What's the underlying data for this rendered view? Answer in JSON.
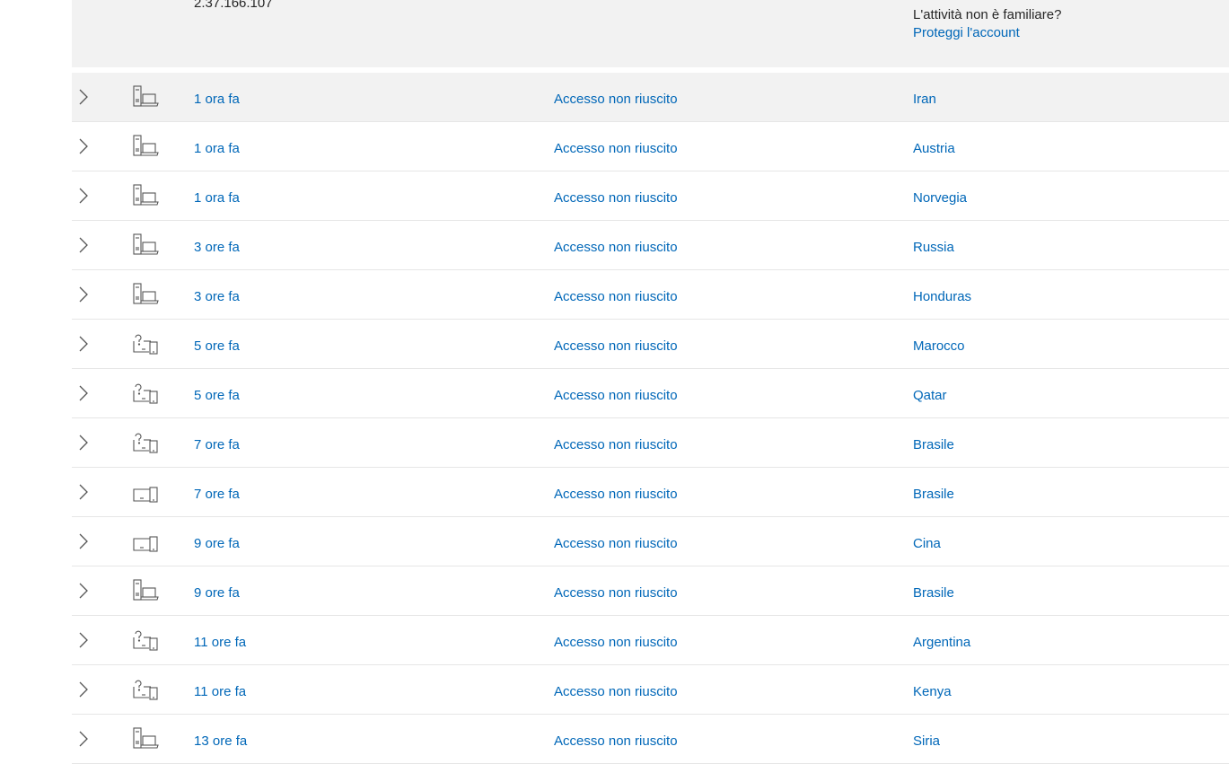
{
  "expanded": {
    "ip": "2.37.166.107",
    "question": "L'attività non è familiare?",
    "link": "Proteggi l'account"
  },
  "icons": {
    "chevron": "chevron-right-icon",
    "computer": "desktop-laptop-icon",
    "unknown": "unknown-device-icon",
    "tablet": "tablet-phone-icon"
  },
  "rows": [
    {
      "time": "1 ora fa",
      "status": "Accesso non riuscito",
      "location": "Iran",
      "device": "computer"
    },
    {
      "time": "1 ora fa",
      "status": "Accesso non riuscito",
      "location": "Austria",
      "device": "computer"
    },
    {
      "time": "1 ora fa",
      "status": "Accesso non riuscito",
      "location": "Norvegia",
      "device": "computer"
    },
    {
      "time": "3 ore fa",
      "status": "Accesso non riuscito",
      "location": "Russia",
      "device": "computer"
    },
    {
      "time": "3 ore fa",
      "status": "Accesso non riuscito",
      "location": "Honduras",
      "device": "computer"
    },
    {
      "time": "5 ore fa",
      "status": "Accesso non riuscito",
      "location": "Marocco",
      "device": "unknown"
    },
    {
      "time": "5 ore fa",
      "status": "Accesso non riuscito",
      "location": "Qatar",
      "device": "unknown"
    },
    {
      "time": "7 ore fa",
      "status": "Accesso non riuscito",
      "location": "Brasile",
      "device": "unknown"
    },
    {
      "time": "7 ore fa",
      "status": "Accesso non riuscito",
      "location": "Brasile",
      "device": "tablet"
    },
    {
      "time": "9 ore fa",
      "status": "Accesso non riuscito",
      "location": "Cina",
      "device": "tablet"
    },
    {
      "time": "9 ore fa",
      "status": "Accesso non riuscito",
      "location": "Brasile",
      "device": "computer"
    },
    {
      "time": "11 ore fa",
      "status": "Accesso non riuscito",
      "location": "Argentina",
      "device": "unknown"
    },
    {
      "time": "11 ore fa",
      "status": "Accesso non riuscito",
      "location": "Kenya",
      "device": "unknown"
    },
    {
      "time": "13 ore fa",
      "status": "Accesso non riuscito",
      "location": "Siria",
      "device": "computer"
    }
  ]
}
